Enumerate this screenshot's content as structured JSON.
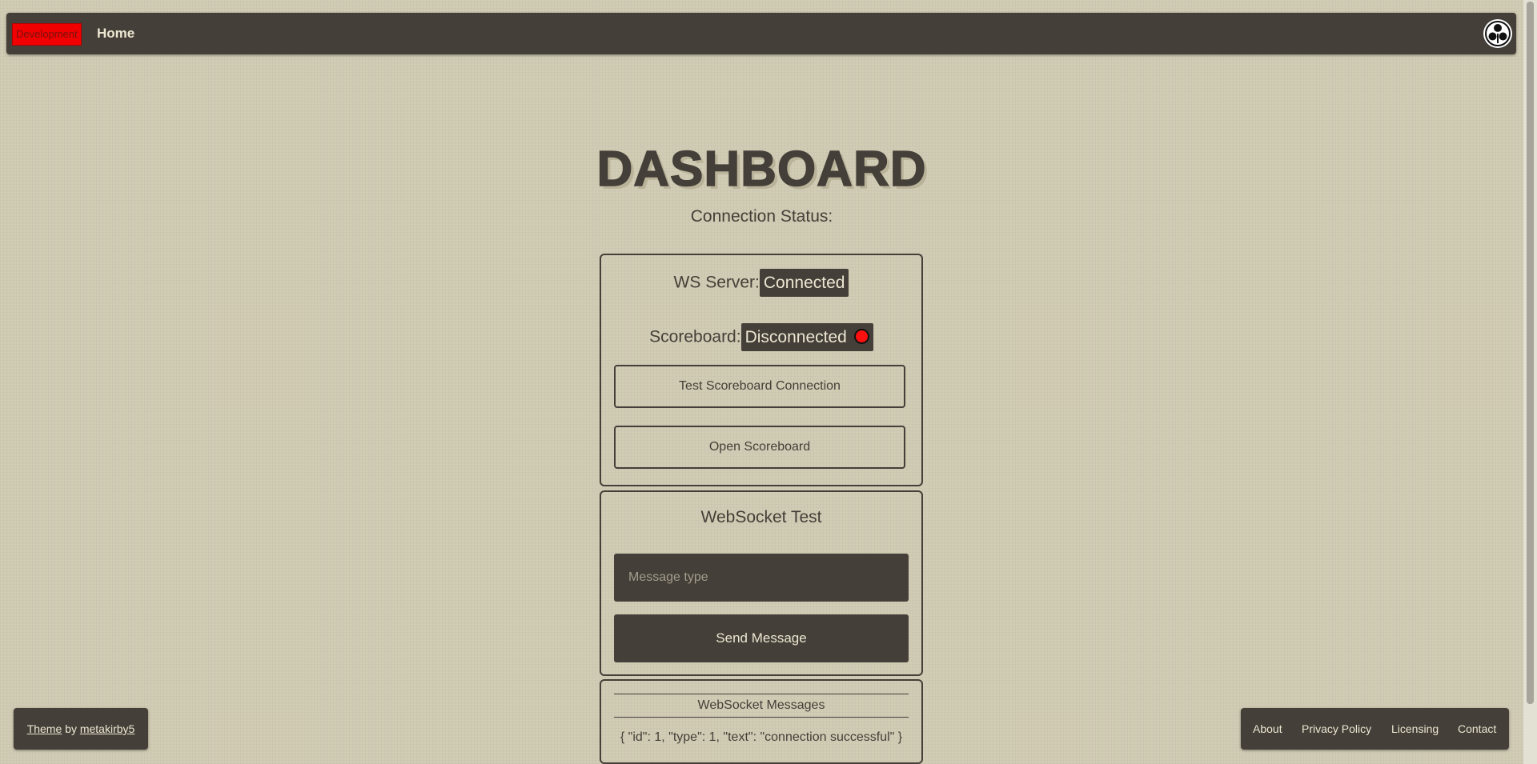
{
  "navbar": {
    "env_badge": "Development",
    "home_label": "Home",
    "logo_icon": "trefoil-logo-icon"
  },
  "main": {
    "title": "DASHBOARD",
    "connection_status_label": "Connection Status:",
    "ws_server": {
      "label": "WS Server:",
      "status": "Connected"
    },
    "scoreboard": {
      "label": "Scoreboard:",
      "status": "Disconnected",
      "indicator_color": "#ff1010"
    },
    "test_scoreboard_button": "Test Scoreboard Connection",
    "open_scoreboard_button": "Open Scoreboard"
  },
  "websocket_test": {
    "title": "WebSocket Test",
    "message_type_placeholder": "Message type",
    "message_type_value": "",
    "send_button": "Send Message"
  },
  "websocket_messages": {
    "title": "WebSocket Messages",
    "items": [
      "{ \"id\": 1, \"type\": 1, \"text\": \"connection successful\" }"
    ]
  },
  "footer": {
    "theme_link": "Theme",
    "by_text": " by ",
    "author_link": "metakirby5",
    "links": [
      "About",
      "Privacy Policy",
      "Licensing",
      "Contact"
    ]
  },
  "colors": {
    "background": "#d1ccb4",
    "primary_dark": "#443f38",
    "light_text": "#ece6d2",
    "env_badge": "#f00000"
  }
}
